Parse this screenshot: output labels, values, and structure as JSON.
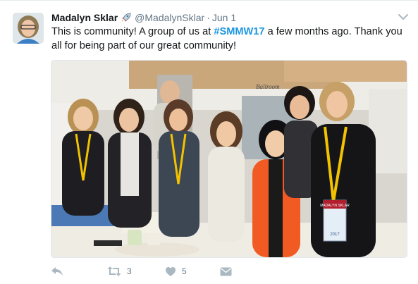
{
  "tweet": {
    "author_name": "Madalyn Sklar",
    "author_handle": "@MadalynSklar",
    "separator": "·",
    "date": "Jun 1",
    "text_before": "This is community! A group of us at ",
    "hashtag": "#SMMW17",
    "text_after": " a few months ago. Thank you all for being part of our great community!",
    "retweet_count": "3",
    "like_count": "5"
  },
  "icons": {
    "verified_emoji": "rocket-icon",
    "menu": "chevron-down-icon",
    "reply": "reply-icon",
    "retweet": "retweet-icon",
    "like": "heart-icon",
    "dm": "envelope-icon"
  },
  "photo": {
    "badge_name": "MADALYN SKLAR",
    "badge_year": "2017",
    "sign_text": "Ballroom"
  },
  "colors": {
    "link": "#1b95e0",
    "muted": "#657786",
    "icon": "#aab8c2",
    "lanyard": "#f2c200",
    "jacket": "#f15a22"
  }
}
